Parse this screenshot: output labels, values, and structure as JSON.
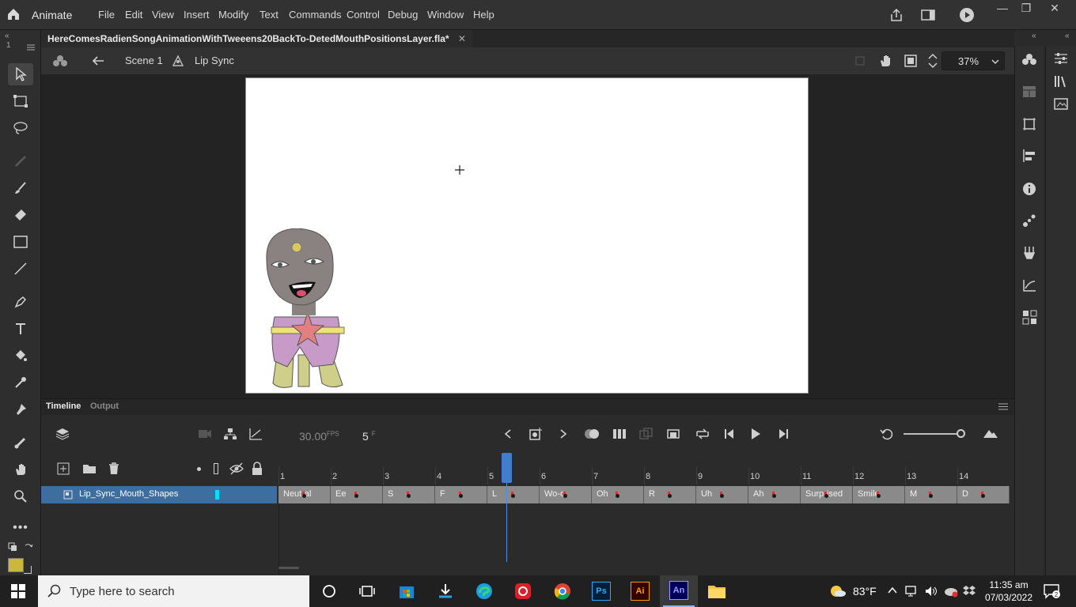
{
  "app": {
    "name": "Animate",
    "menus": [
      "File",
      "Edit",
      "View",
      "Insert",
      "Modify",
      "Text",
      "Commands",
      "Control",
      "Debug",
      "Window",
      "Help"
    ]
  },
  "document": {
    "tab_title": "HereComesRadienSongAnimationWithTweeens20BackTo-DetedMouthPositionsLayer.fla*",
    "tab_number": "1"
  },
  "editbar": {
    "scene": "Scene 1",
    "symbol": "Lip Sync",
    "zoom": "37%"
  },
  "timeline": {
    "tabs": [
      "Timeline",
      "Output"
    ],
    "fps_value": "30.00",
    "fps_unit": "FPS",
    "current_frame": "5",
    "frame_unit": "F",
    "frame_numbers": [
      "1",
      "2",
      "3",
      "4",
      "5",
      "6",
      "7",
      "8",
      "9",
      "10",
      "11",
      "12",
      "13",
      "14"
    ],
    "layer_name": "Lip_Sync_Mouth_Shapes",
    "keyframes": [
      "Neutral",
      "Ee",
      "S",
      "F",
      "L",
      "Wo-o",
      "Oh",
      "R",
      "Uh",
      "Ah",
      "Surprised",
      "Smile",
      "M",
      "D"
    ],
    "layer_color": "#00e0ff",
    "playhead_frame": 5
  },
  "taskbar": {
    "search_placeholder": "Type here to search",
    "weather": "83°F",
    "time": "11:35 am",
    "date": "07/03/2022"
  },
  "colors": {
    "fill_swatch": "#c9b83a",
    "playhead": "#3f7fcc",
    "layer_selected": "#3d6ea0"
  }
}
